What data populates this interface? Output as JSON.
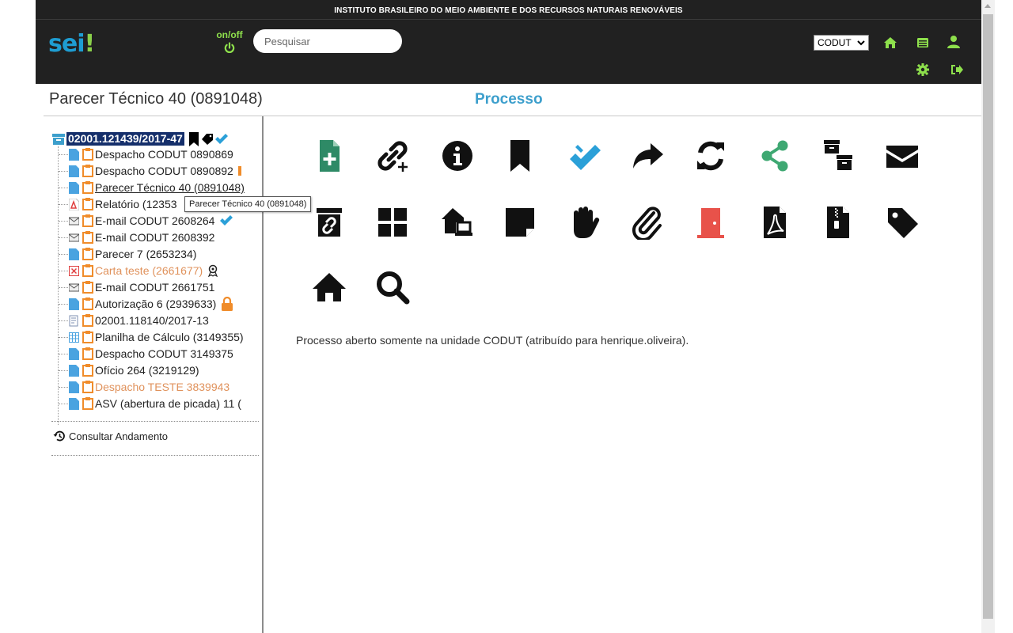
{
  "header": {
    "institution": "INSTITUTO BRASILEIRO DO MEIO AMBIENTE E DOS RECURSOS NATURAIS RENOVÁVEIS",
    "logo_text": "sei",
    "logo_mark": "!",
    "onoff_label": "on/off",
    "search_placeholder": "Pesquisar",
    "unit_selected": "CODUT",
    "icons": [
      "home-icon",
      "list-icon",
      "user-icon",
      "settings-icon",
      "logout-icon"
    ],
    "accent_color": "#8ee04c"
  },
  "page": {
    "title": "Parecer Técnico 40 (0891048)",
    "section_title": "Processo"
  },
  "tree": {
    "root": "02001.121439/2017-47",
    "items": [
      {
        "label": "Despacho CODUT 0890869",
        "type": "doc"
      },
      {
        "label": "Despacho CODUT 0890892",
        "type": "doc"
      },
      {
        "label": "Parecer Técnico 40 (0891048)",
        "type": "doc"
      },
      {
        "label": "Relatório (12353",
        "type": "pdf"
      },
      {
        "label": "E-mail CODUT 2608264",
        "type": "mail"
      },
      {
        "label": "E-mail CODUT 2608392",
        "type": "mail"
      },
      {
        "label": "Parecer 7 (2653234)",
        "type": "doc"
      },
      {
        "label": "Carta teste (2661677)",
        "type": "cancel"
      },
      {
        "label": "E-mail CODUT 2661751",
        "type": "mail"
      },
      {
        "label": "Autorização 6 (2939633)",
        "type": "doc"
      },
      {
        "label": "02001.118140/2017-13",
        "type": "process"
      },
      {
        "label": "Planilha de Cálculo (3149355)",
        "type": "sheet"
      },
      {
        "label": "Despacho CODUT 3149375",
        "type": "doc"
      },
      {
        "label": "Ofício 264 (3219129)",
        "type": "doc"
      },
      {
        "label": "Despacho TESTE 3839943",
        "type": "doc"
      },
      {
        "label": "ASV (abertura de picada) 11 (",
        "type": "doc"
      }
    ],
    "tooltip": "Parecer Técnico 40 (0891048)",
    "consultar": "Consultar Andamento"
  },
  "actions": [
    "new-document-icon",
    "link-process-icon",
    "info-icon",
    "bookmark-icon",
    "double-check-icon",
    "forward-icon",
    "refresh-icon",
    "share-icon",
    "archive-icon",
    "email-icon",
    "unlink-icon",
    "grid-icon",
    "remote-work-icon",
    "note-icon",
    "hand-stop-icon",
    "attachment-icon",
    "exit-door-icon",
    "pdf-icon",
    "zip-icon",
    "tag-icon",
    "home-icon",
    "search-icon"
  ],
  "status": "Processo aberto somente na unidade CODUT (atribuído para henrique.oliveira).",
  "colors": {
    "header_bg": "#212121",
    "tree_root_bg": "#152f6b",
    "section_blue": "#3d9fcc",
    "doc_blue": "#4aa3e0",
    "clip_orange": "#f08c2a",
    "check_blue": "#2ba0d8",
    "share_green": "#3ea872",
    "door_red": "#e8524a",
    "new_doc_green": "#2e8a66"
  }
}
